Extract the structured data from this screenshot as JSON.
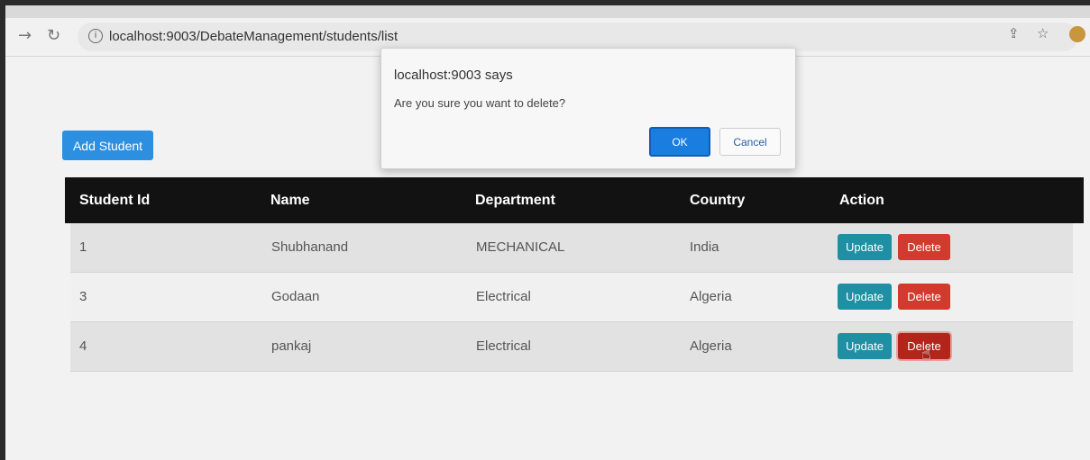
{
  "browser": {
    "url": "localhost:9003/DebateManagement/students/list",
    "icons": [
      "back-arrow-icon",
      "reload-icon",
      "info-icon",
      "share-icon",
      "star-icon",
      "profile-avatar"
    ]
  },
  "toolbar": {
    "add_label": "Add Student"
  },
  "table": {
    "columns": [
      "Student Id",
      "Name",
      "Department",
      "Country",
      "Action"
    ],
    "rows": [
      {
        "id": "1",
        "name": "Shubhanand",
        "department": "MECHANICAL",
        "country": "India",
        "update": "Update",
        "delete": "Delete"
      },
      {
        "id": "3",
        "name": "Godaan",
        "department": "Electrical",
        "country": "Algeria",
        "update": "Update",
        "delete": "Delete"
      },
      {
        "id": "4",
        "name": "pankaj",
        "department": "Electrical",
        "country": "Algeria",
        "update": "Update",
        "delete": "Delete"
      }
    ]
  },
  "dialog": {
    "title": "localhost:9003 says",
    "message": "Are you sure you want to delete?",
    "ok_label": "OK",
    "cancel_label": "Cancel"
  },
  "colors": {
    "add_button": "#2d8fe0",
    "update_button": "#1f8fa3",
    "delete_button": "#d33a2e",
    "table_header": "#121212",
    "ok_button": "#1a7ee0"
  }
}
